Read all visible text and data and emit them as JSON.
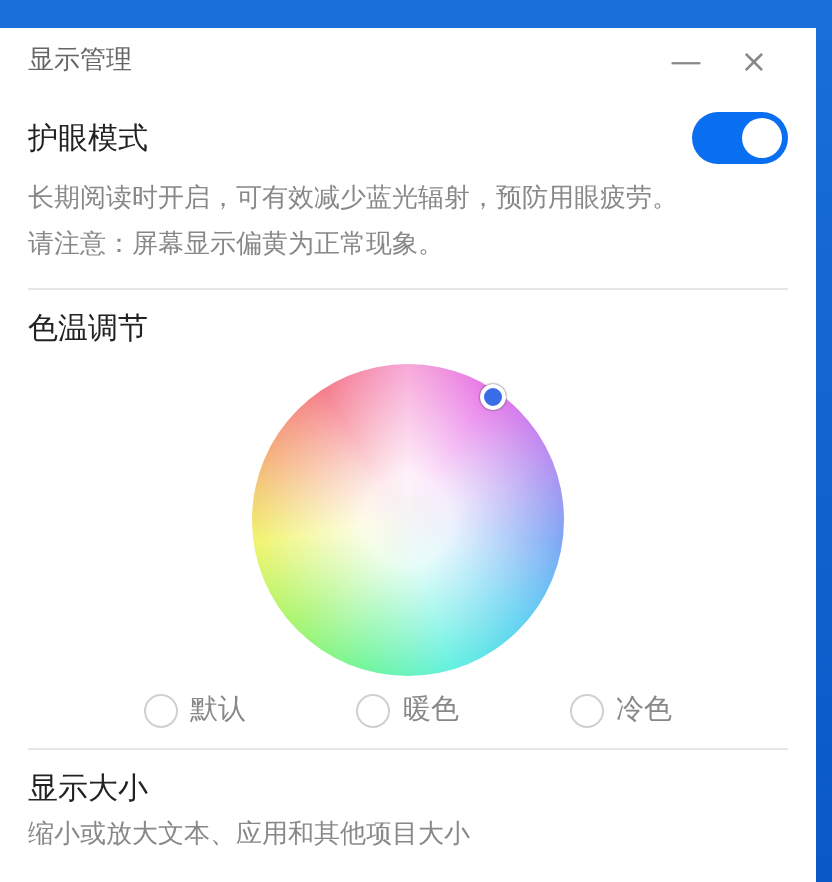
{
  "window": {
    "title": "显示管理",
    "minimize": "—",
    "close": "×"
  },
  "eye_care": {
    "title": "护眼模式",
    "on": true,
    "description": [
      "长期阅读时开启，可有效减少蓝光辐射，预防用眼疲劳。",
      "请注意：屏幕显示偏黄为正常现象。"
    ]
  },
  "color_temperature": {
    "title": "色温调节",
    "options": [
      {
        "label": "默认",
        "selected": false
      },
      {
        "label": "暖色",
        "selected": false
      },
      {
        "label": "冷色",
        "selected": false
      }
    ]
  },
  "display_size": {
    "title": "显示大小",
    "description": "缩小或放大文本、应用和其他项目大小"
  }
}
